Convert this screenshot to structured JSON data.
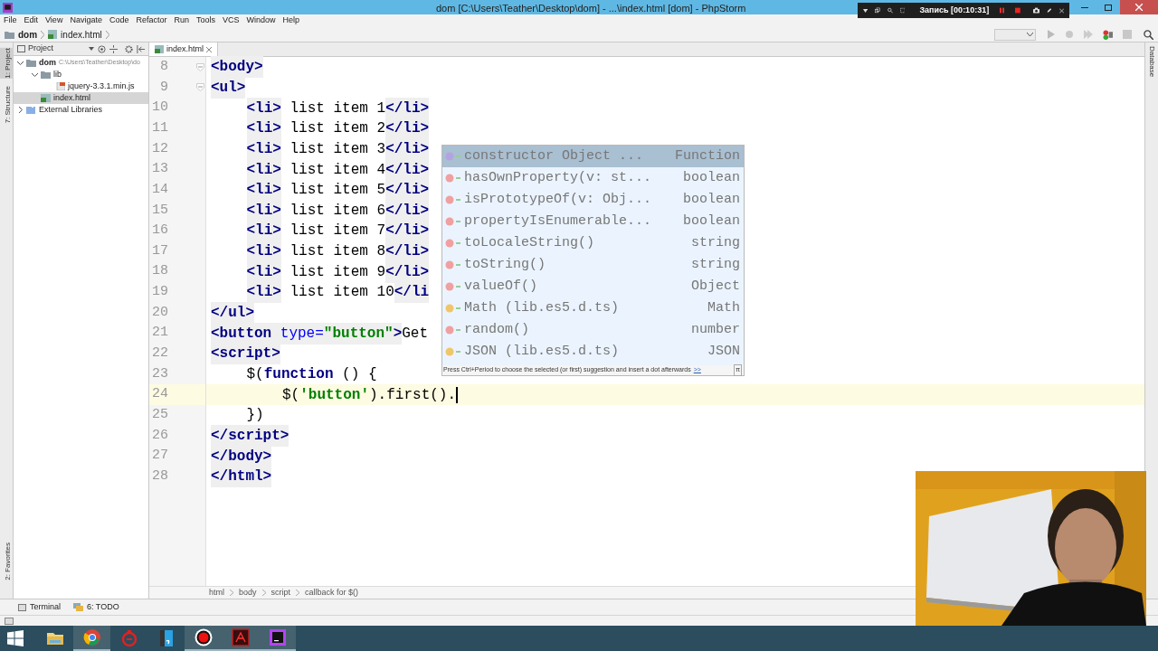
{
  "window": {
    "title": "dom [C:\\Users\\Teather\\Desktop\\dom] - ...\\index.html [dom] - PhpStorm"
  },
  "recorder": {
    "label": "Запись [00:10:31]"
  },
  "menu": [
    "File",
    "Edit",
    "View",
    "Navigate",
    "Code",
    "Refactor",
    "Run",
    "Tools",
    "VCS",
    "Window",
    "Help"
  ],
  "nav_bar": [
    "dom",
    "index.html"
  ],
  "left_stripe": [
    {
      "label": "1: Project",
      "selected": true
    },
    {
      "label": "7: Structure",
      "selected": false
    },
    {
      "label": "2: Favorites",
      "selected": false
    }
  ],
  "right_stripe": [
    "Database"
  ],
  "project_panel": {
    "title": "Project",
    "tree": [
      {
        "label": "dom",
        "path": "C:\\Users\\Teather\\Desktop\\do",
        "kind": "folder",
        "expanded": true,
        "selected": false,
        "children": [
          {
            "label": "lib",
            "kind": "folder",
            "expanded": true,
            "selected": false,
            "children": [
              {
                "label": "jquery-3.3.1.min.js",
                "kind": "js",
                "selected": false
              }
            ]
          },
          {
            "label": "index.html",
            "kind": "html",
            "selected": true
          }
        ]
      },
      {
        "label": "External Libraries",
        "kind": "library",
        "expanded": false,
        "selected": false
      }
    ]
  },
  "editor": {
    "tab": "index.html",
    "lines": [
      {
        "number": "8",
        "current": false,
        "segments": [
          {
            "kind": "tag",
            "text": "<body>"
          }
        ]
      },
      {
        "number": "9",
        "current": false,
        "segments": [
          {
            "kind": "tag",
            "text": "<ul>"
          }
        ],
        "children": [
          {
            "number": "10",
            "current": false,
            "segments": [
              {
                "kind": "tag",
                "text": "<li>"
              },
              {
                "kind": "text",
                "text": " list item 1"
              },
              {
                "kind": "tag",
                "text": "</li>"
              }
            ]
          },
          {
            "number": "11",
            "current": false,
            "segments": [
              {
                "kind": "tag",
                "text": "<li>"
              },
              {
                "kind": "text",
                "text": " list item 2"
              },
              {
                "kind": "tag",
                "text": "</li>"
              }
            ]
          },
          {
            "number": "12",
            "current": false,
            "segments": [
              {
                "kind": "tag",
                "text": "<li>"
              },
              {
                "kind": "text",
                "text": " list item 3"
              },
              {
                "kind": "tag",
                "text": "</li>"
              }
            ]
          },
          {
            "number": "13",
            "current": false,
            "segments": [
              {
                "kind": "tag",
                "text": "<li>"
              },
              {
                "kind": "text",
                "text": " list item 4"
              },
              {
                "kind": "tag",
                "text": "</li>"
              }
            ]
          },
          {
            "number": "14",
            "current": false,
            "segments": [
              {
                "kind": "tag",
                "text": "<li>"
              },
              {
                "kind": "text",
                "text": " list item 5"
              },
              {
                "kind": "tag",
                "text": "</li>"
              }
            ]
          },
          {
            "number": "15",
            "current": false,
            "segments": [
              {
                "kind": "tag",
                "text": "<li>"
              },
              {
                "kind": "text",
                "text": " list item 6"
              },
              {
                "kind": "tag",
                "text": "</li>"
              }
            ]
          },
          {
            "number": "16",
            "current": false,
            "segments": [
              {
                "kind": "tag",
                "text": "<li>"
              },
              {
                "kind": "text",
                "text": " list item 7"
              },
              {
                "kind": "tag",
                "text": "</li>"
              }
            ]
          },
          {
            "number": "17",
            "current": false,
            "segments": [
              {
                "kind": "tag",
                "text": "<li>"
              },
              {
                "kind": "text",
                "text": " list item 8"
              },
              {
                "kind": "tag",
                "text": "</li>"
              }
            ]
          },
          {
            "number": "18",
            "current": false,
            "segments": [
              {
                "kind": "tag",
                "text": "<li>"
              },
              {
                "kind": "text",
                "text": " list item 9"
              },
              {
                "kind": "tag",
                "text": "</li>"
              }
            ]
          },
          {
            "number": "19",
            "current": false,
            "segments": [
              {
                "kind": "tag",
                "text": "<li>"
              },
              {
                "kind": "text",
                "text": " list item 10"
              },
              {
                "kind": "tag",
                "text": "</li"
              }
            ]
          }
        ]
      },
      {
        "number": "20",
        "current": false,
        "segments": [
          {
            "kind": "tag",
            "text": "</ul>"
          }
        ]
      },
      {
        "number": "21",
        "current": false,
        "segments": [
          {
            "kind": "tag",
            "text": "<button "
          },
          {
            "kind": "attr",
            "text": "type="
          },
          {
            "kind": "value",
            "text": "\"button\""
          },
          {
            "kind": "tag",
            "text": ">"
          },
          {
            "kind": "text",
            "text": "Get"
          }
        ]
      },
      {
        "number": "22",
        "current": false,
        "segments": [
          {
            "kind": "tag",
            "text": "<script>"
          }
        ],
        "children": [
          {
            "number": "23",
            "current": false,
            "segments": [
              {
                "kind": "plain",
                "text": "$("
              },
              {
                "kind": "keyword",
                "text": "function"
              },
              {
                "kind": "plain",
                "text": " () {"
              }
            ],
            "children": [
              {
                "number": "24",
                "current": true,
                "segments": [
                  {
                    "kind": "plain",
                    "text": "$("
                  },
                  {
                    "kind": "string",
                    "text": "'button'"
                  },
                  {
                    "kind": "plain",
                    "text": ").first()."
                  }
                ]
              }
            ]
          },
          {
            "number": "25",
            "current": false,
            "segments": [
              {
                "kind": "plain",
                "text": "})"
              }
            ]
          }
        ]
      },
      {
        "number": "26",
        "current": false,
        "segments": [
          {
            "kind": "tag",
            "text": "</script>"
          }
        ]
      },
      {
        "number": "27",
        "current": false,
        "segments": [
          {
            "kind": "tag",
            "text": "</body>"
          }
        ]
      },
      {
        "number": "28",
        "current": false,
        "segments": [
          {
            "kind": "tag",
            "text": "</html>"
          }
        ]
      }
    ],
    "breadcrumbs": [
      "html",
      "body",
      "script",
      "callback for $()"
    ]
  },
  "completion": {
    "items": [
      {
        "kind": "property",
        "name": "constructor Object ...",
        "type": "Function",
        "selected": true
      },
      {
        "kind": "method",
        "name": "hasOwnProperty(v: st...",
        "type": "boolean",
        "selected": false
      },
      {
        "kind": "method",
        "name": "isPrototypeOf(v: Obj...",
        "type": "boolean",
        "selected": false
      },
      {
        "kind": "method",
        "name": "propertyIsEnumerable...",
        "type": "boolean",
        "selected": false
      },
      {
        "kind": "method",
        "name": "toLocaleString()",
        "type": "string",
        "selected": false
      },
      {
        "kind": "method",
        "name": "toString()",
        "type": "string",
        "selected": false
      },
      {
        "kind": "method",
        "name": "valueOf()",
        "type": "Object",
        "selected": false
      },
      {
        "kind": "variable",
        "name": "Math (lib.es5.d.ts)",
        "type": "Math",
        "selected": false
      },
      {
        "kind": "method",
        "name": "random()",
        "type": "number",
        "selected": false
      },
      {
        "kind": "variable",
        "name": "JSON (lib.es5.d.ts)",
        "type": "JSON",
        "selected": false
      }
    ],
    "hint": "Press Ctrl+Period to choose the selected (or first) suggestion and insert a dot afterwards",
    "hint_link": ">>",
    "pi": "π"
  },
  "tool_windows": [
    {
      "label": "Terminal",
      "kind": "terminal"
    },
    {
      "label": "6: TODO",
      "kind": "todo"
    }
  ],
  "taskbar": [
    {
      "kind": "folder",
      "selected": false
    },
    {
      "kind": "browser",
      "selected": true
    },
    {
      "kind": "target",
      "selected": false
    },
    {
      "kind": "app",
      "selected": false
    },
    {
      "kind": "record",
      "selected": true
    },
    {
      "kind": "pdf",
      "selected": true
    },
    {
      "kind": "ide",
      "selected": true
    }
  ],
  "webcam": {
    "kind": "picture"
  }
}
